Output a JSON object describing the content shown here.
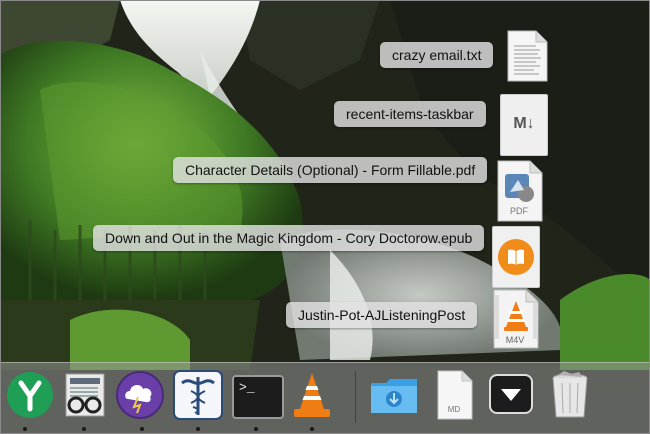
{
  "stack_items": [
    {
      "name": "crazy email.txt",
      "icon": "text-document-icon"
    },
    {
      "name": "recent-items-taskbar",
      "icon": "markdown-file-icon"
    },
    {
      "name": "Character Details (Optional) - Form Fillable.pdf",
      "icon": "pdf-document-icon"
    },
    {
      "name": "Down and Out in the Magic Kingdom - Cory Doctorow.epub",
      "icon": "ibooks-icon"
    },
    {
      "name": "Justin-Pot-AJListeningPost",
      "icon": "m4v-video-icon"
    }
  ],
  "file_badges": {
    "markdown": "M↓",
    "pdf": "PDF",
    "m4v": "M4V",
    "md": "MD"
  },
  "terminal_prompt": ">_",
  "dock": {
    "apps": [
      "Yoink",
      "News reader",
      "Cloud app",
      "Medical app",
      "Terminal",
      "VLC"
    ],
    "folders": [
      "Downloads",
      "MD document",
      "Recent items stack",
      "Trash"
    ],
    "colors": {
      "green": "#1f9e55",
      "purple": "#6a3fa8",
      "blue": "#3aa0e6",
      "orange": "#f07d14"
    }
  }
}
